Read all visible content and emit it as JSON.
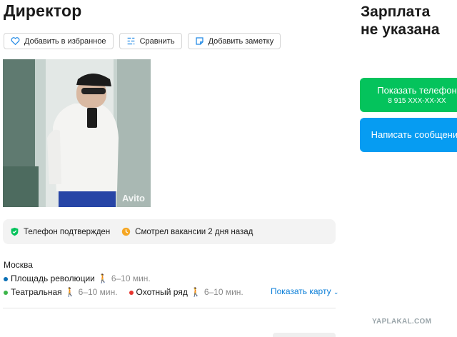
{
  "vacancy": {
    "title": "Директор"
  },
  "actions": {
    "favorite_label": "Добавить в избранное",
    "compare_label": "Сравнить",
    "note_label": "Добавить заметку"
  },
  "photo": {
    "watermark": "Avito"
  },
  "info": {
    "phone_verified": "Телефон подтвержден",
    "last_seen": "Смотрел вакансии 2 дня назад"
  },
  "location": {
    "city": "Москва",
    "stations": [
      {
        "name": "Площадь революции",
        "time": "6–10 мин.",
        "color": "#0a6fb5"
      },
      {
        "name": "Театральная",
        "time": "6–10 мин.",
        "color": "#3cb54a"
      },
      {
        "name": "Охотный ряд",
        "time": "6–10 мин.",
        "color": "#e6342e"
      }
    ],
    "map_link": "Показать карту"
  },
  "salary": {
    "line1": "Зарплата",
    "line2": "не указана"
  },
  "contact": {
    "show_phone_label": "Показать телефон",
    "phone_masked": "8 915 XXX-XX-XX",
    "message_label": "Написать сообщение"
  },
  "site_watermark": "YAPLAKAL.COM",
  "colors": {
    "green": "#04c35c",
    "blue": "#069cf2",
    "link": "#0a7ed8"
  }
}
